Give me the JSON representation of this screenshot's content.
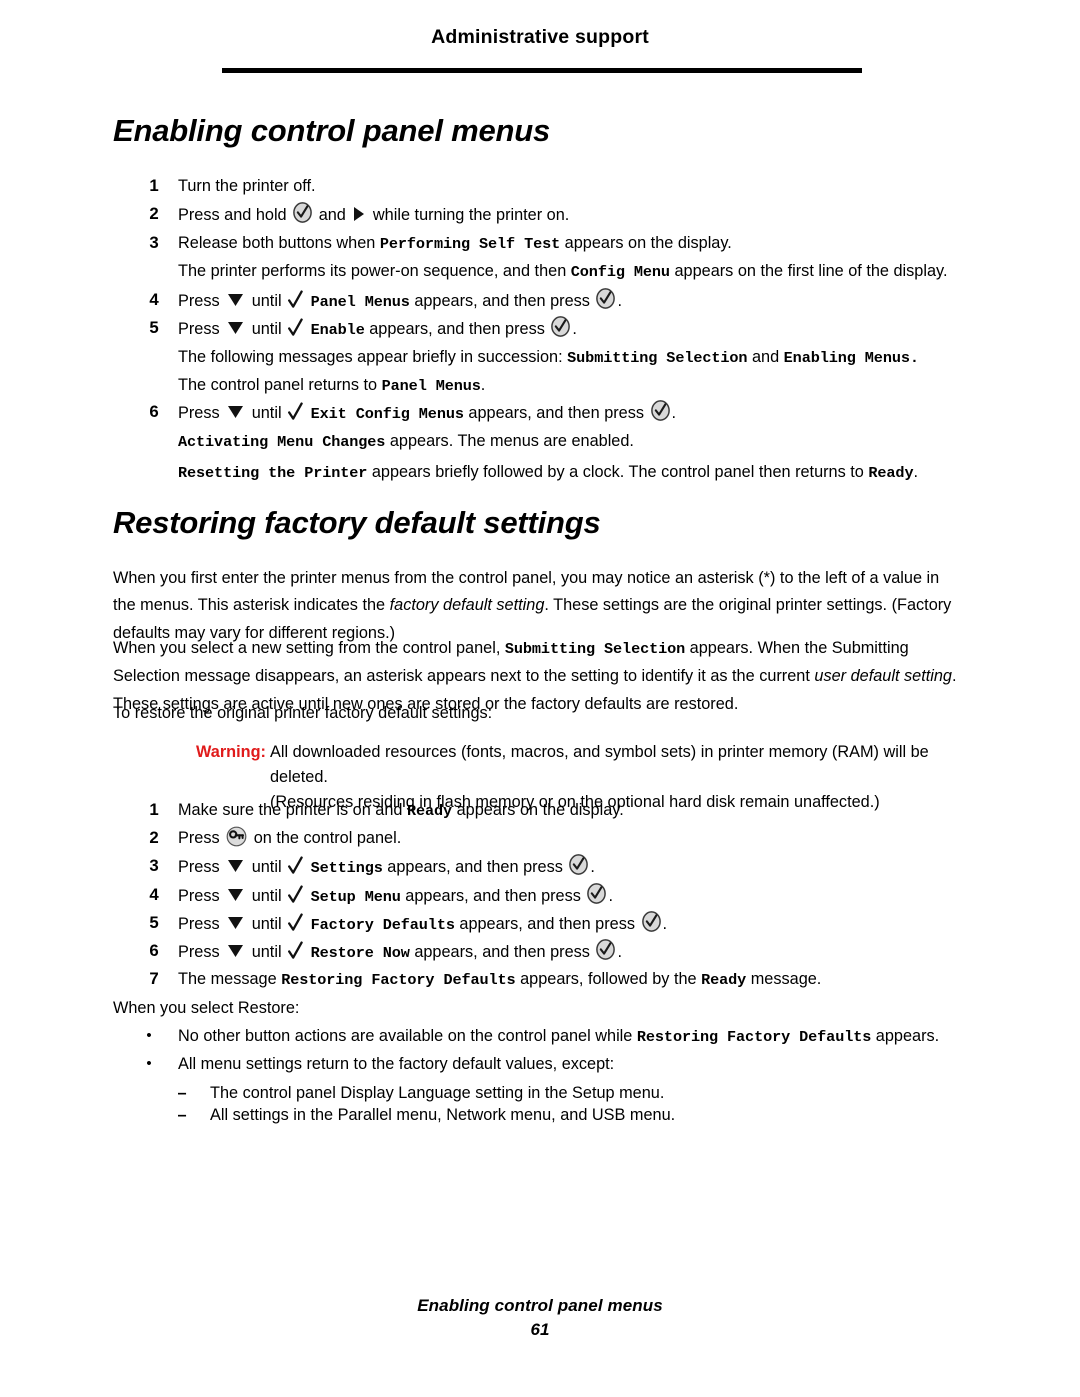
{
  "header": {
    "title": "Administrative support"
  },
  "sections": {
    "enabling": {
      "heading": "Enabling control panel menus",
      "steps": [
        {
          "num": "1",
          "text": "Turn the printer off."
        },
        {
          "num": "2",
          "pre": "Press and hold",
          "mid": "and",
          "post": "while turning the printer on."
        },
        {
          "num": "3",
          "pre": "Release both buttons when",
          "display": "Performing Self Test",
          "post": "appears on the display."
        },
        {
          "num": "4",
          "pre": "Press",
          "mid": "until",
          "display": "Panel Menus",
          "post": "appears, and then press",
          "tail": "."
        },
        {
          "num": "5",
          "pre": "Press",
          "mid": "until",
          "display": "Enable",
          "post": "appears, and then press",
          "tail": "."
        },
        {
          "num": "6",
          "pre": "Press",
          "mid": "until",
          "display": "Exit Config Menus",
          "post": "appears, and then press",
          "tail": "."
        }
      ],
      "note_after_3": {
        "pre": "The printer performs its power-on sequence, and then",
        "display": "Config Menu",
        "post": "appears on the first line of the display."
      },
      "note_after_5a": {
        "pre": "The following messages appear briefly in succession:",
        "display1": "Submitting Selection",
        "mid": "and",
        "display2": "Enabling Menus."
      },
      "note_after_5b": {
        "pre": "The control panel returns to",
        "display": "Panel Menus",
        "post": "."
      },
      "note_after_6a": {
        "display": "Activating Menu Changes",
        "post": "appears. The menus are enabled."
      },
      "note_after_6b": {
        "display": "Resetting the Printer",
        "mid": "appears briefly followed by a clock. The control panel then returns to",
        "display2": "Ready",
        "post": "."
      }
    },
    "restoring": {
      "heading": "Restoring factory default settings",
      "para1": {
        "a": "When you first enter the printer menus from the control panel, you may notice an asterisk (*) to the left of a value in the menus. This asterisk indicates the ",
        "italic": "factory default setting",
        "b": ". These settings are the original printer settings. (Factory defaults may vary for different regions.)"
      },
      "para2": {
        "a": "When you select a new setting from the control panel, ",
        "display": "Submitting Selection",
        "b": " appears. When the Submitting Selection message disappears, an asterisk appears next to the setting to identify it as the current ",
        "italic": "user default setting",
        "c": ". These settings are active until new ones are stored or the factory defaults are restored."
      },
      "para3": "To restore the original printer factory default settings:",
      "warning": {
        "label": "Warning:",
        "line1": "All downloaded resources (fonts, macros, and symbol sets) in printer memory (RAM) will be deleted.",
        "line2": "(Resources residing in flash memory or on the optional hard disk remain unaffected.)",
        "color": "#e01b1b"
      },
      "steps": [
        {
          "num": "1",
          "pre": "Make sure the printer is on and",
          "display": "Ready",
          "post": "appears on the display."
        },
        {
          "num": "2",
          "pre": "Press",
          "post": "on the control panel."
        },
        {
          "num": "3",
          "pre": "Press",
          "mid": "until",
          "display": "Settings",
          "post": "appears, and then press",
          "tail": "."
        },
        {
          "num": "4",
          "pre": "Press",
          "mid": "until",
          "display": "Setup Menu",
          "post": "appears, and then press",
          "tail": "."
        },
        {
          "num": "5",
          "pre": "Press",
          "mid": "until",
          "display": "Factory Defaults",
          "post": "appears, and then press",
          "tail": "."
        },
        {
          "num": "6",
          "pre": "Press",
          "mid": "until",
          "display": "Restore Now",
          "post": "appears, and then press",
          "tail": "."
        },
        {
          "num": "7",
          "pre": "The message",
          "display": "Restoring Factory Defaults",
          "mid": "appears, followed by the",
          "display2": "Ready",
          "post": "message."
        }
      ],
      "restore_intro": "When you select Restore:",
      "bullets": [
        {
          "pre": "No other button actions are available on the control panel while",
          "display": "Restoring Factory Defaults",
          "post": "appears."
        },
        {
          "pre": "All menu settings return to the factory default values, except:"
        }
      ],
      "subbullets": [
        "The control panel Display Language setting in the Setup menu.",
        "All settings in the Parallel menu, Network menu, and USB menu."
      ],
      "bullet_glyph": "•",
      "dash_glyph": "–"
    }
  },
  "footer": {
    "title": "Enabling control panel menus",
    "page": "61"
  },
  "icons": {
    "select": "select-check-button-icon",
    "menu": "menu-key-button-icon",
    "down": "down-arrow-button-icon",
    "right": "right-arrow-button-icon",
    "check": "checkmark-marker-icon"
  }
}
